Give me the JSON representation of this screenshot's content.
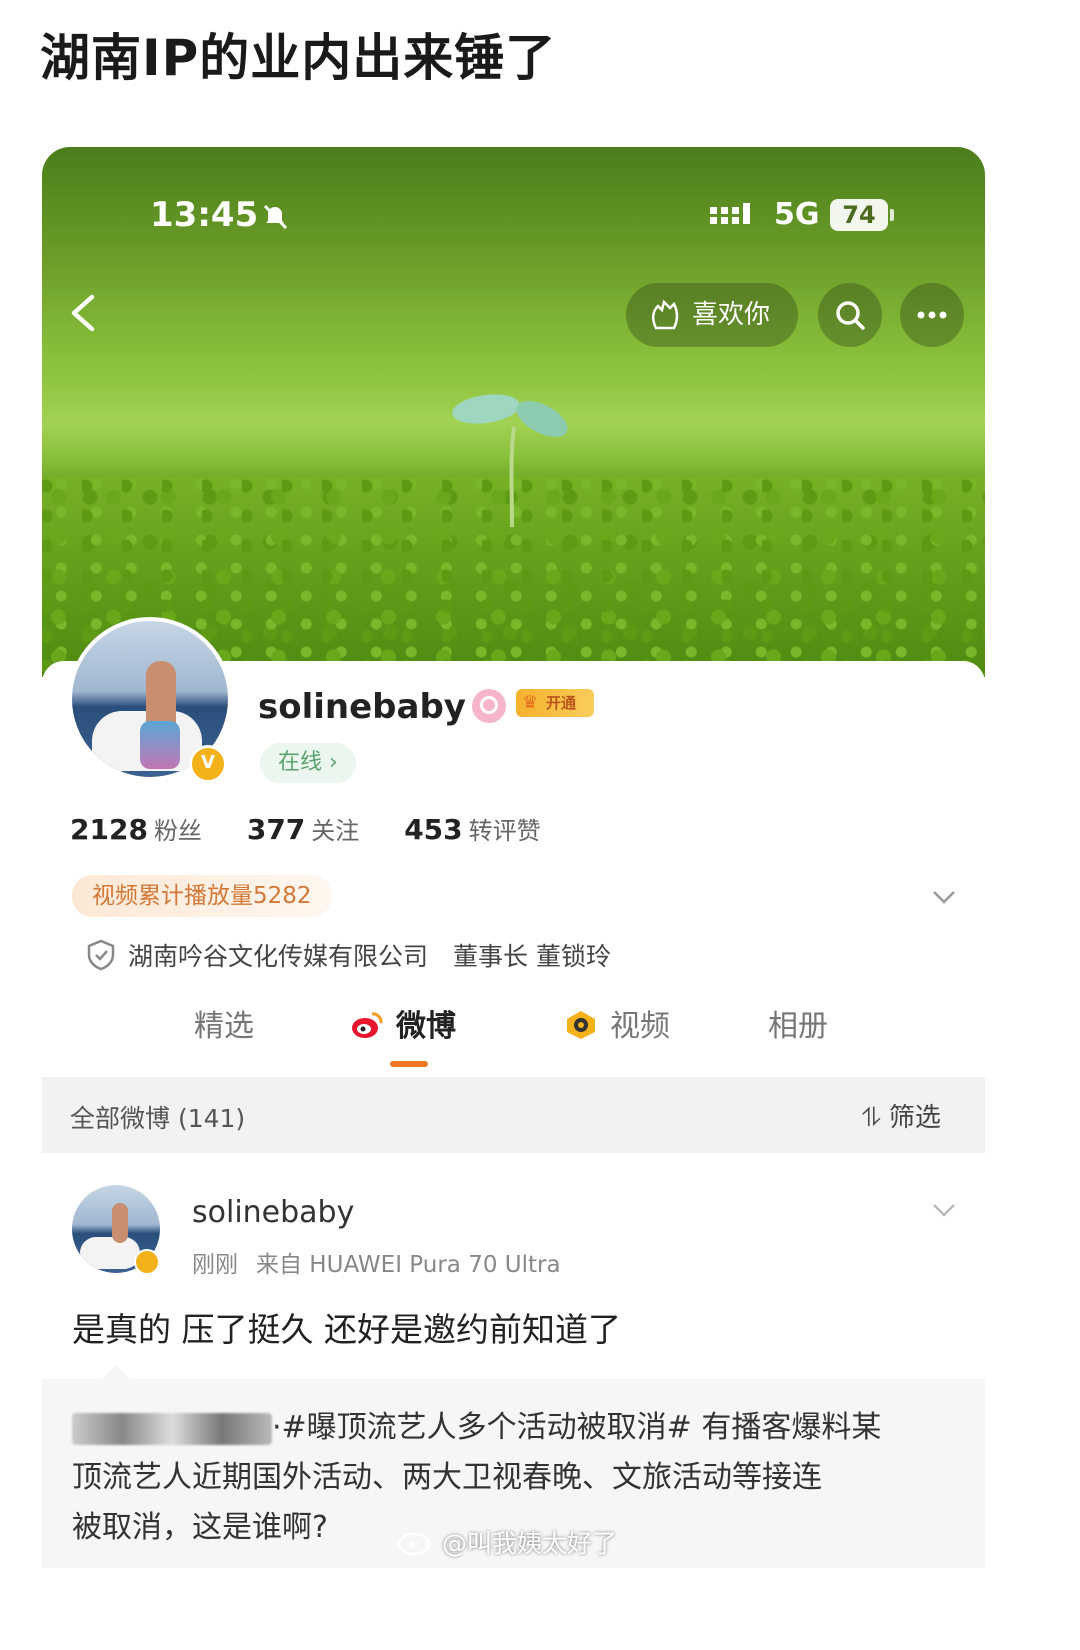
{
  "post_title": "湖南IP的业内出来锤了",
  "status_bar": {
    "time": "13:45",
    "network": "5G",
    "battery": "74"
  },
  "nav": {
    "like_label": "喜欢你"
  },
  "profile": {
    "username": "solinebaby",
    "vip_label": "开通",
    "online_label": "在线 ›",
    "stats": [
      {
        "value": "2128",
        "label": "粉丝"
      },
      {
        "value": "377",
        "label": "关注"
      },
      {
        "value": "453",
        "label": "转评赞"
      }
    ],
    "video_tag": "视频累计播放量5282",
    "company": "湖南吟谷文化传媒有限公司　董事长 董锁玲"
  },
  "tabs": [
    {
      "label": "精选"
    },
    {
      "label": "微博"
    },
    {
      "label": "视频"
    },
    {
      "label": "相册"
    }
  ],
  "filter_bar": {
    "all_label": "全部微博 (141)",
    "filter_label": "筛选"
  },
  "post": {
    "author": "solinebaby",
    "time": "刚刚",
    "source": "来自 HUAWEI Pura 70 Ultra",
    "text": "是真的 压了挺久 还好是邀约前知道了",
    "quote_prefix": "·#曝顶流艺人多个活动被取消# 有播客爆料某",
    "quote_line2": "顶流艺人近期国外活动、两大卫视春晚、文旅活动等接连",
    "quote_line3": "被取消，这是谁啊?"
  },
  "watermark": "@叫我姨太好了",
  "colors": {
    "accent": "#f07a23",
    "vip": "#f5b12c",
    "online": "#5aa36d"
  }
}
